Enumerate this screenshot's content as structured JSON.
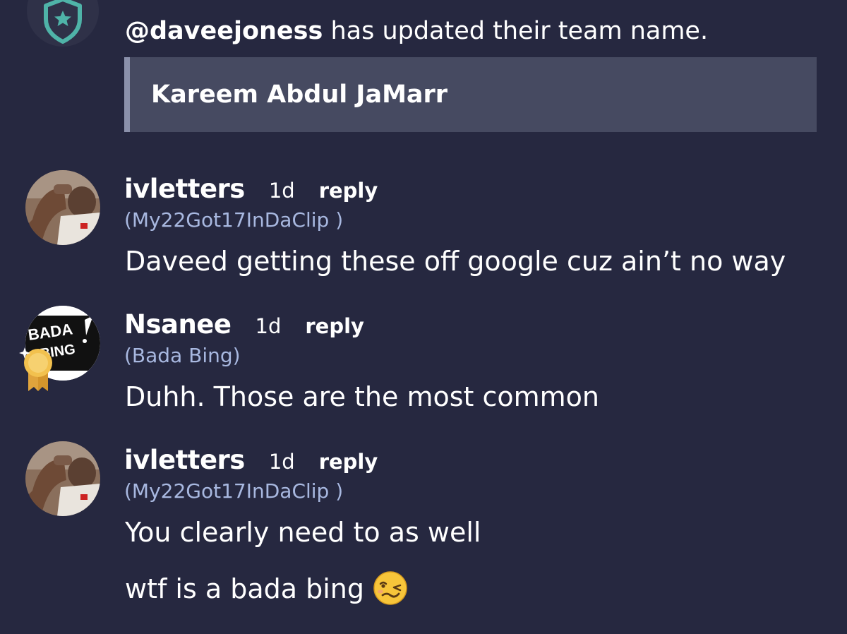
{
  "system_message": {
    "mention": "@daveejoness",
    "text": " has updated their team name.",
    "quote": "Kareem Abdul JaMarr"
  },
  "messages": [
    {
      "username": "ivletters",
      "time": "1d",
      "reply_label": "reply",
      "team": "(My22Got17InDaClip )",
      "lines": [
        "Daveed getting these off google cuz ain’t no way"
      ]
    },
    {
      "username": "Nsanee",
      "time": "1d",
      "reply_label": "reply",
      "team": "(Bada Bing)",
      "avatar_text": [
        "BADA",
        "BING"
      ],
      "lines": [
        "Duhh. Those are the most common"
      ]
    },
    {
      "username": "ivletters",
      "time": "1d",
      "reply_label": "reply",
      "team": "(My22Got17InDaClip )",
      "lines": [
        "You clearly need to as well",
        "wtf is a bada bing"
      ]
    }
  ],
  "icons": {
    "system": "shield-star-icon",
    "medal": "medal-icon",
    "emoji": "woozy-face-emoji"
  },
  "colors": {
    "background": "#262840",
    "quote_background": "#464a61",
    "quote_border": "#8b91ab",
    "team_text": "#a8b8e0",
    "shield": "#4fb3a8"
  }
}
